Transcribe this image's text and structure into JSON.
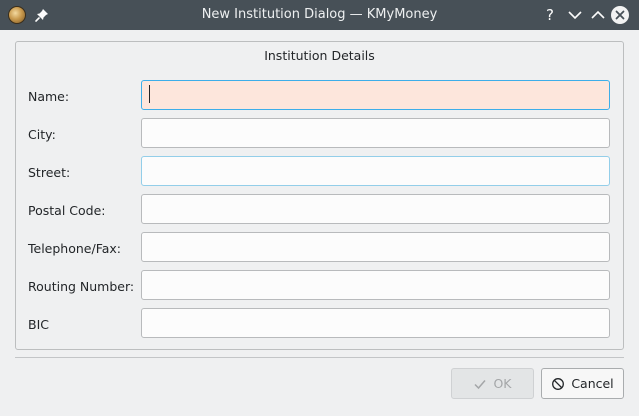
{
  "window": {
    "title": "New Institution Dialog — KMyMoney",
    "help_symbol": "?"
  },
  "icons": {
    "app": "kmymoney-app-icon",
    "pin": "pin-icon",
    "minimize": "chevron-down-icon",
    "maximize": "chevron-up-icon",
    "close": "close-icon",
    "ok": "checkmark-icon",
    "cancel": "cancel-circle-icon"
  },
  "group": {
    "title": "Institution Details"
  },
  "fields": {
    "name": {
      "label": "Name:",
      "value": ""
    },
    "city": {
      "label": "City:",
      "value": ""
    },
    "street": {
      "label": "Street:",
      "value": ""
    },
    "postal_code": {
      "label": "Postal Code:",
      "value": ""
    },
    "telephone": {
      "label": "Telephone/Fax:",
      "value": ""
    },
    "routing_number": {
      "label": "Routing Number:",
      "value": ""
    },
    "bic": {
      "label": "BIC",
      "value": ""
    }
  },
  "buttons": {
    "ok_label": "OK",
    "ok_enabled": false,
    "cancel_label": "Cancel"
  },
  "colors": {
    "titlebar": "#475057",
    "required_field_bg": "#fde6dc",
    "focus_accent": "#3daee9"
  }
}
